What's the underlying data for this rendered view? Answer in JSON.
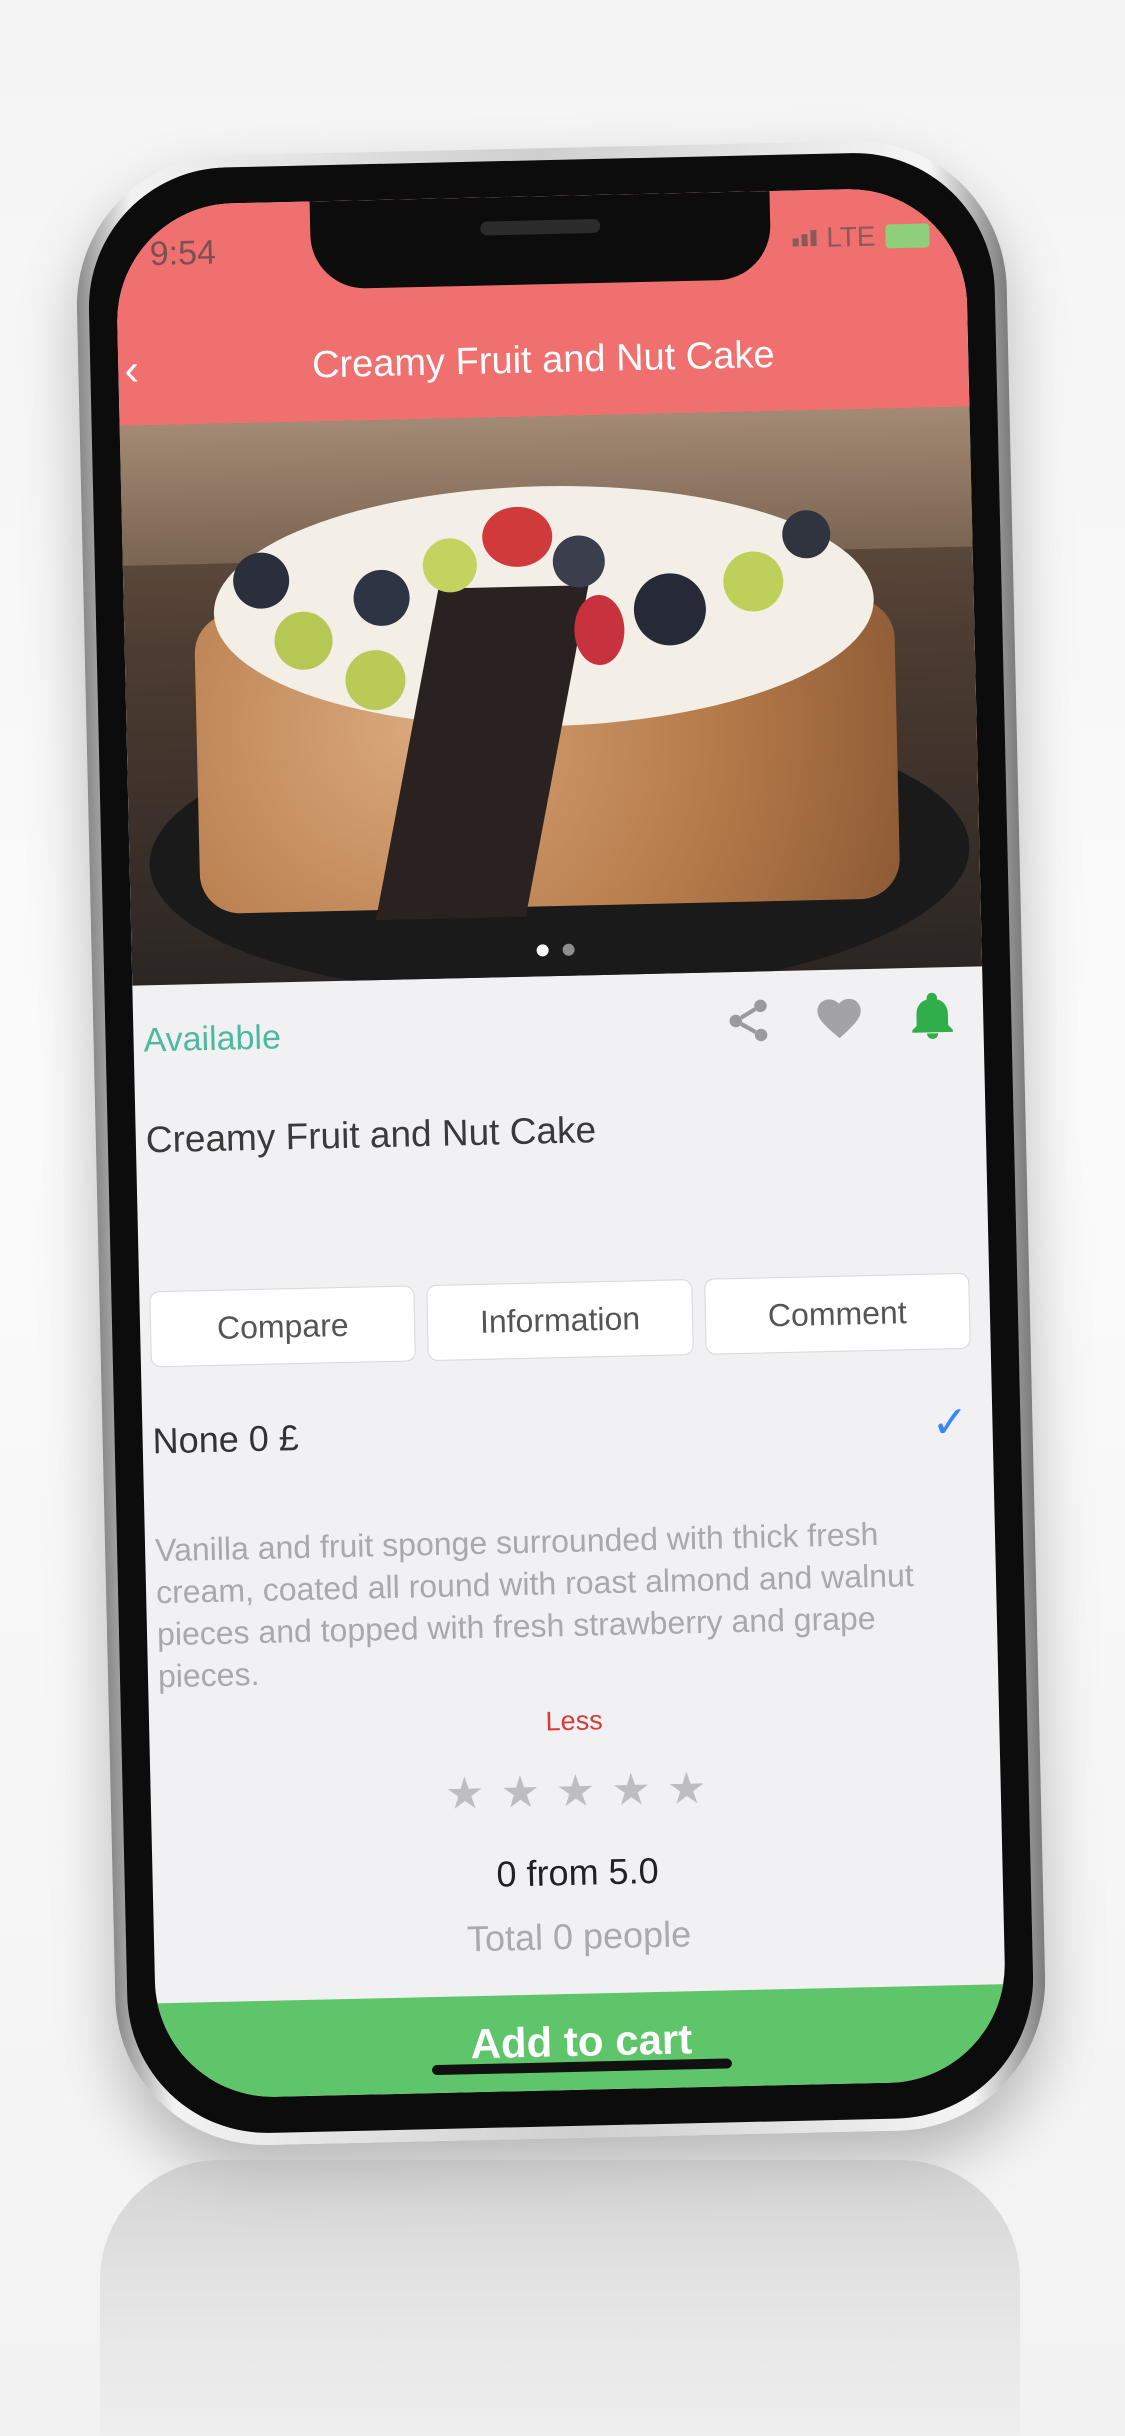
{
  "status_bar": {
    "time": "9:54",
    "network": "LTE"
  },
  "header": {
    "title": "Creamy Fruit and Nut Cake",
    "back_icon": "chevron-left-icon"
  },
  "product": {
    "availability": "Available",
    "title": "Creamy Fruit and Nut Cake",
    "action_icons": [
      "share-icon",
      "heart-icon",
      "bell-icon"
    ]
  },
  "tabs": [
    {
      "label": "Compare"
    },
    {
      "label": "Information"
    },
    {
      "label": "Comment"
    }
  ],
  "option": {
    "label": "None 0 £"
  },
  "description": {
    "text": "Vanilla and fruit sponge surrounded with thick fresh cream, coated all round with roast almond and walnut pieces and topped with fresh strawberry and grape pieces.",
    "toggle_label": "Less"
  },
  "rating": {
    "stars": 0,
    "max": 5,
    "value_text": "0 from 5.0",
    "count_text": "Total 0 people"
  },
  "cart": {
    "label": "Add to cart"
  },
  "colors": {
    "header": "#f07070",
    "available": "#4db9a0",
    "bell": "#2fae4a",
    "cart": "#5ec56a",
    "less": "#d83a3a",
    "check": "#3a86ff"
  }
}
